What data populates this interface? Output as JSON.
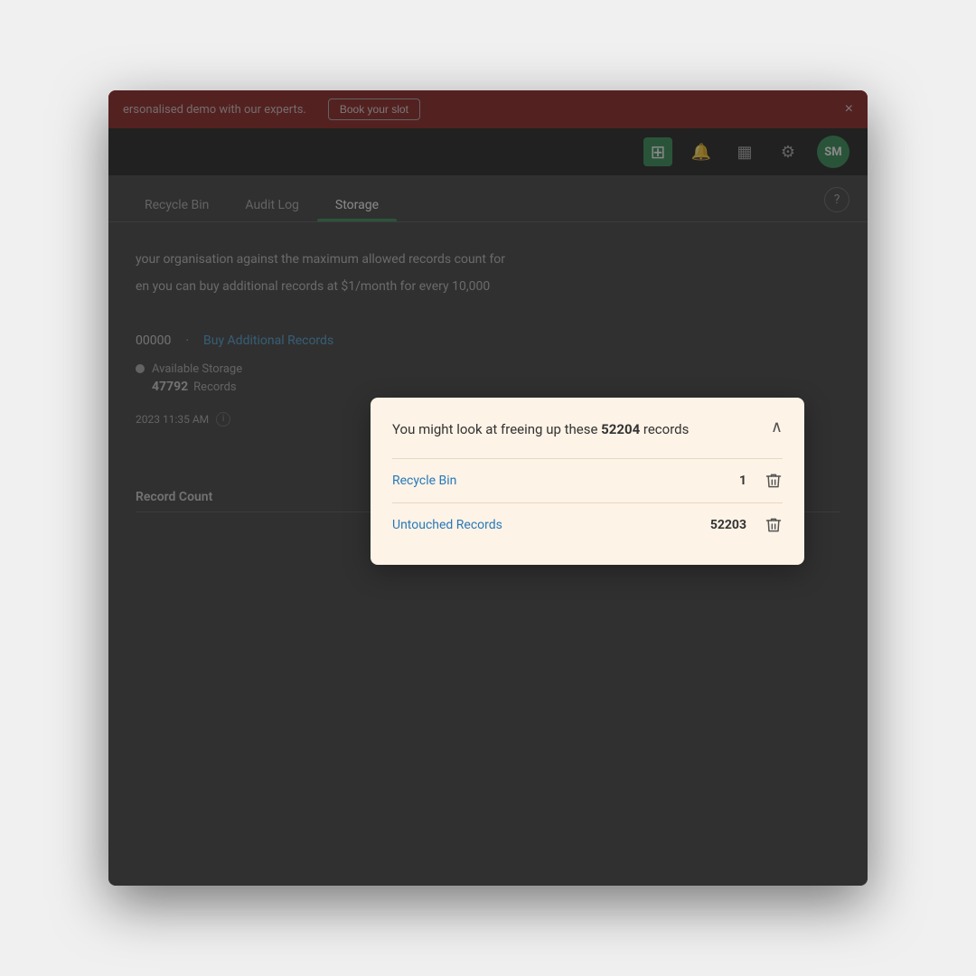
{
  "banner": {
    "text": "ersonalised demo with our experts.",
    "button_label": "Book your slot",
    "close_label": "×"
  },
  "header": {
    "add_icon": "+",
    "bell_icon": "🔔",
    "settings_icon": "⚙",
    "avatar_initials": "SM"
  },
  "tabs": [
    {
      "label": "Recycle Bin",
      "active": false
    },
    {
      "label": "Audit Log",
      "active": false
    },
    {
      "label": "Storage",
      "active": true
    }
  ],
  "help_label": "?",
  "main": {
    "description_line1": "your organisation against the maximum allowed records count for",
    "description_line2": "en you can buy additional records at $1/month for every 10,000",
    "records_display": "00000",
    "buy_link_label": "Buy Additional Records",
    "available_storage_label": "Available Storage",
    "records_count": "47792",
    "records_suffix": "Records",
    "timestamp": "2023 11:35 AM",
    "record_count_header": "Record Count"
  },
  "popup": {
    "title_prefix": "You might look at freeing up these ",
    "title_count": "52204",
    "title_suffix": " records",
    "collapse_label": "^",
    "recycle_bin": {
      "label": "Recycle Bin",
      "count": "1"
    },
    "untouched_records": {
      "label": "Untouched Records",
      "count": "52203"
    },
    "background_color": "#fdf3e7"
  }
}
